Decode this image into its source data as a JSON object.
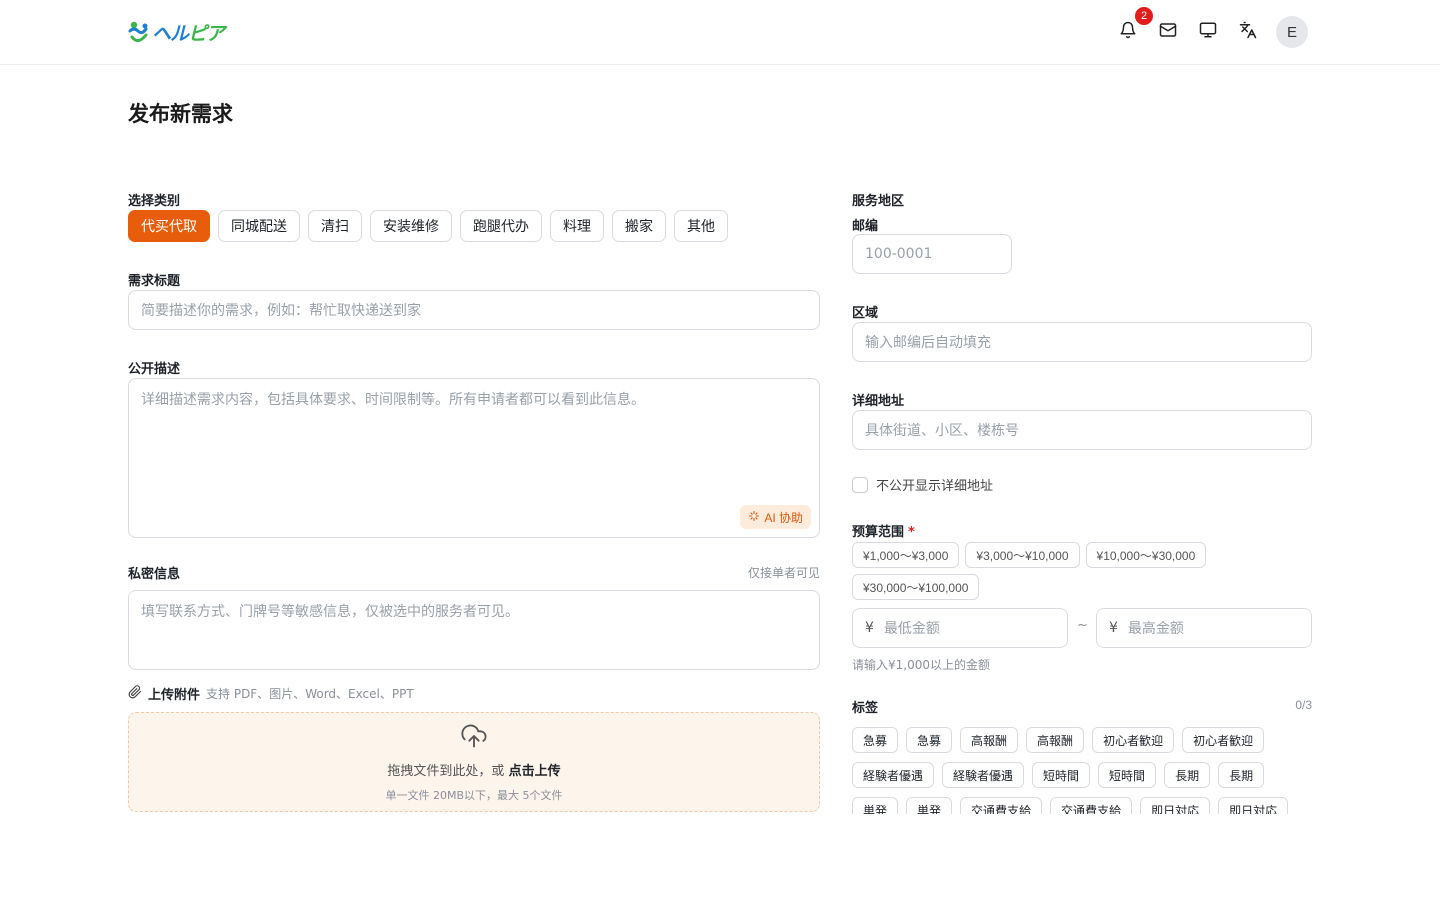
{
  "header": {
    "logo_text_a": "ヘル",
    "logo_text_b": "ピア",
    "notification_count": "2",
    "avatar_initial": "E",
    "icons": [
      "bell-icon",
      "mail-icon",
      "monitor-icon",
      "translate-icon"
    ]
  },
  "page": {
    "title": "发布新需求"
  },
  "category": {
    "label": "选择类别",
    "items": [
      "代买代取",
      "同城配送",
      "清扫",
      "安装维修",
      "跑腿代办",
      "料理",
      "搬家",
      "其他"
    ],
    "selected": "代买代取"
  },
  "title_field": {
    "label": "需求标题",
    "placeholder": "简要描述你的需求，例如：帮忙取快递送到家"
  },
  "public_desc": {
    "label": "公开描述",
    "placeholder": "详细描述需求内容，包括具体要求、时间限制等。所有申请者都可以看到此信息。",
    "ai_label": "AI 协助"
  },
  "private_info": {
    "label": "私密信息",
    "hint": "仅接单者可见",
    "placeholder": "填写联系方式、门牌号等敏感信息，仅被选中的服务者可见。"
  },
  "upload": {
    "label": "上传附件",
    "hint": "支持 PDF、图片、Word、Excel、PPT",
    "drop_text": "拖拽文件到此处，或",
    "click_text": "点击上传",
    "limit_text": "单一文件 20MB以下，最大 5个文件"
  },
  "service_area": {
    "label": "服务地区",
    "postal_label": "邮编",
    "postal_placeholder": "100-0001",
    "region_label": "区域",
    "region_placeholder": "输入邮编后自动填充",
    "address_label": "详细地址",
    "address_placeholder": "具体街道、小区、楼栋号",
    "hide_address_label": "不公开显示详细地址"
  },
  "budget": {
    "label": "预算范围",
    "required_mark": "*",
    "presets": [
      "¥1,000〜¥3,000",
      "¥3,000〜¥10,000",
      "¥10,000〜¥30,000",
      "¥30,000〜¥100,000"
    ],
    "currency": "¥",
    "min_placeholder": "最低金额",
    "max_placeholder": "最高金额",
    "separator": "~",
    "note": "请输入¥1,000以上的金额"
  },
  "tags": {
    "label": "标签",
    "count": "0/3",
    "items": [
      "急募",
      "急募",
      "高報酬",
      "高報酬",
      "初心者歓迎",
      "初心者歓迎",
      "経験者優遇",
      "経験者優遇",
      "短時間",
      "短時間",
      "長期",
      "長期",
      "単発",
      "単発",
      "交通費支給",
      "交通費支給",
      "即日対応",
      "即日対応"
    ]
  },
  "colors": {
    "accent": "#e85d0c",
    "badge": "#e11d1d",
    "dropzone_bg": "#fdf4ec"
  }
}
